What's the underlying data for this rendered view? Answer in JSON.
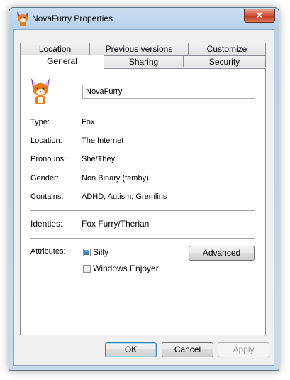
{
  "window": {
    "title": "NovaFurry Properties",
    "close_label": "✕"
  },
  "tabs_back": [
    "Location",
    "Previous versions",
    "Customize"
  ],
  "tabs_front": [
    "General",
    "Sharing",
    "Security"
  ],
  "general": {
    "name_value": "NovaFurry",
    "fields": [
      {
        "label": "Type:",
        "value": "Fox"
      },
      {
        "label": "Location:",
        "value": "The Internet"
      },
      {
        "label": "Pronouns:",
        "value": "She/They"
      },
      {
        "label": "Gender:",
        "value": "Non Binary (femby)"
      },
      {
        "label": "Contains:",
        "value": "ADHD, Autism, Gremlins"
      }
    ],
    "identity": {
      "label": "Identies:",
      "value": "Fox Furry/Therian"
    },
    "attributes_label": "Attributes:",
    "checkboxes": [
      {
        "label": "Silly",
        "checked": true
      },
      {
        "label": "Windows Enjoyer",
        "checked": false
      }
    ],
    "advanced_label": "Advanced"
  },
  "buttons": {
    "ok": "OK",
    "cancel": "Cancel",
    "apply": "Apply"
  }
}
